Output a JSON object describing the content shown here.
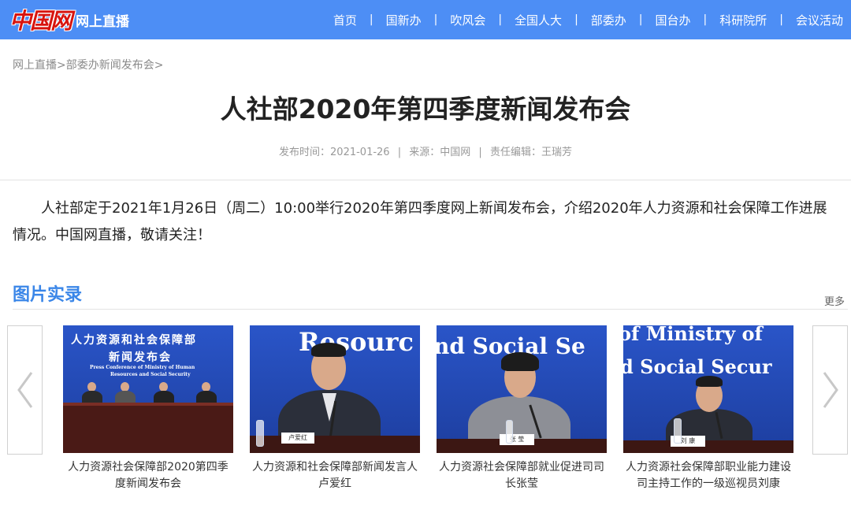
{
  "header": {
    "logo_mark": "中国网",
    "logo_sub": "网上直播",
    "nav": [
      "首页",
      "国新办",
      "吹风会",
      "全国人大",
      "部委办",
      "国台办",
      "科研院所",
      "会议活动"
    ],
    "nav_separator": "|"
  },
  "breadcrumb": [
    "网上直播>",
    "部委办新闻发布会>"
  ],
  "article": {
    "title": "人社部2020年第四季度新闻发布会",
    "meta_publish_time": "发布时间：2021-01-26",
    "meta_source": "来源：中国网",
    "meta_editor": "责任编辑：王瑞芳",
    "meta_separator": "|",
    "intro": "人社部定于2021年1月26日（周二）10:00举行2020年第四季度网上新闻发布会，介绍2020年人力资源和社会保障工作进展情况。中国网直播，敬请关注！"
  },
  "photos_section": {
    "heading": "图片实录",
    "more_label": "更多",
    "cards": [
      {
        "caption": "人力资源社会保障部2020第四季度新闻发布会",
        "banner_line1": "人力资源和社会保障部",
        "banner_line2": "新闻发布会",
        "banner_en1": "Press Conference of Ministry of Human",
        "banner_en2": "Resources and Social Security"
      },
      {
        "caption": "人力资源和社会保障部新闻发言人 卢爱红",
        "banner_line1": "Resourc",
        "nameplate": "卢爱红"
      },
      {
        "caption": "人力资源社会保障部就业促进司司长张莹",
        "banner_line1": "nd Social Se",
        "nameplate": "张 莹"
      },
      {
        "caption": "人力资源社会保障部职业能力建设司主持工作的一级巡视员刘康",
        "banner_line1": "of Ministry of",
        "banner_line2": "d Social Secur",
        "nameplate": "刘 康"
      }
    ]
  },
  "colors": {
    "header_bg": "#4d8ef5",
    "accent": "#3a86e8",
    "logo_red": "#d7140f"
  }
}
